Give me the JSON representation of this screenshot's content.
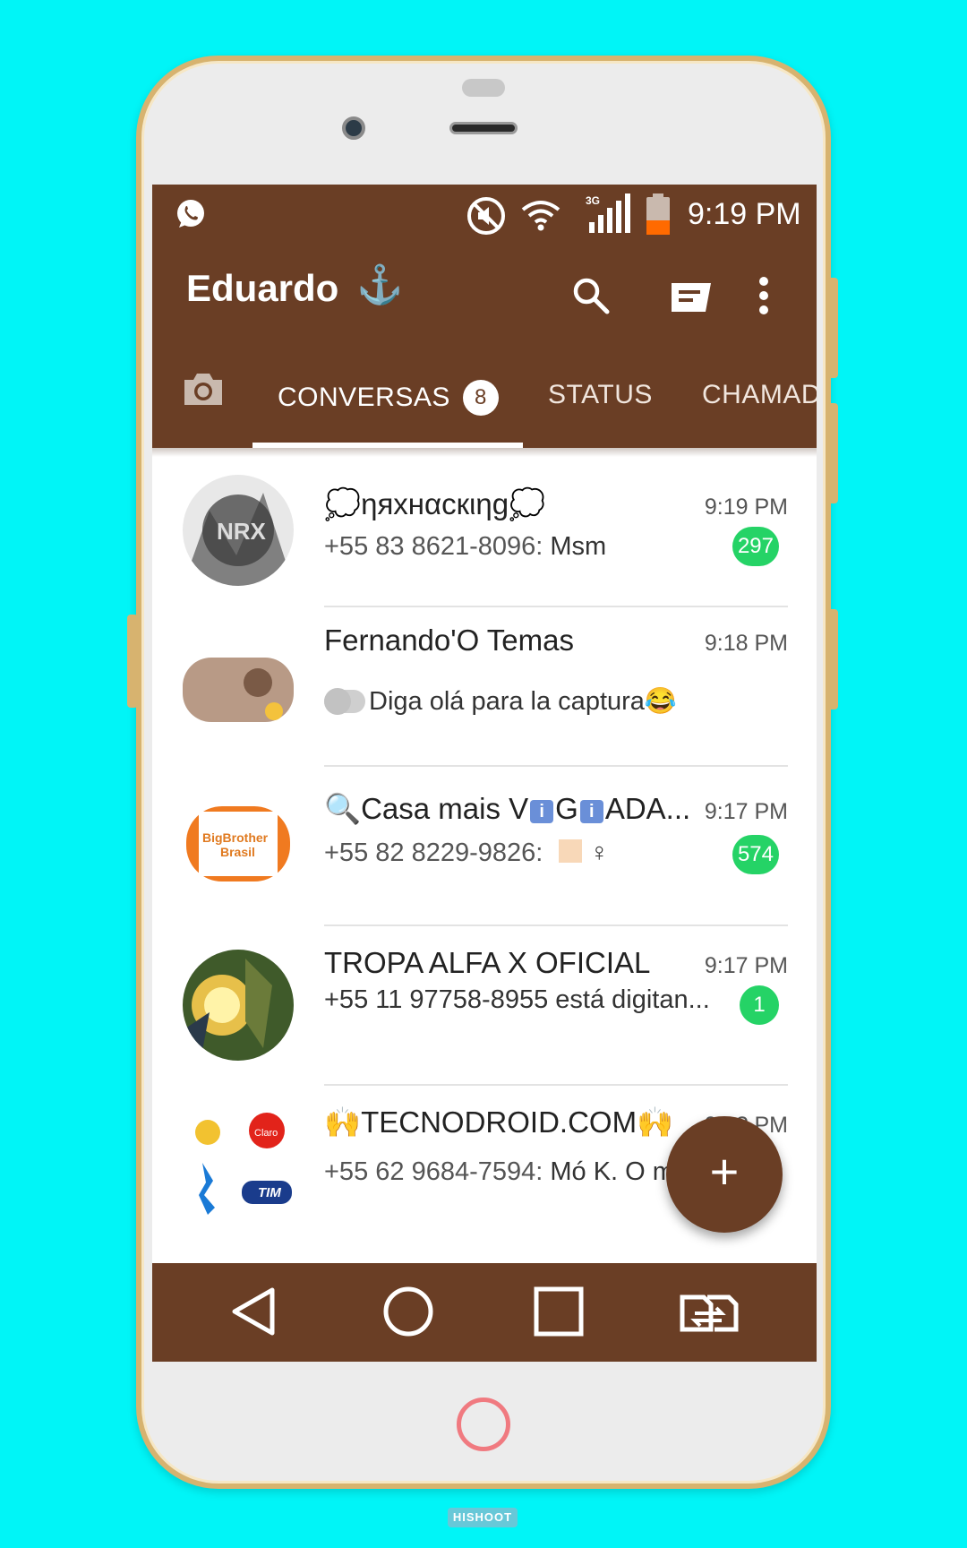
{
  "status_bar": {
    "time": "9:19 PM",
    "network": "3G"
  },
  "app_bar": {
    "title": "Eduardo",
    "title_emoji": "⚓"
  },
  "tabs": [
    {
      "label": "CONVERSAS",
      "badge": "8"
    },
    {
      "label": "STATUS"
    },
    {
      "label": "CHAMADAS"
    }
  ],
  "chats": [
    {
      "name": "💭ηяxнαcкιηg💭",
      "time": "9:19 PM",
      "sender": "+55 83 8621-8096:",
      "message": "Msm",
      "unread": "297"
    },
    {
      "name": "Fernando'O Temas",
      "time": "9:18 PM",
      "sender": "",
      "message": "Diga olá para la captura😂",
      "unread": ""
    },
    {
      "name_prefix": "🔍Casa mais V",
      "name_mid": "G",
      "name_suffix": "ADA...",
      "name_info": "i",
      "time": "9:17 PM",
      "sender": "+55 82 8229-9826:",
      "message": "♀",
      "unread": "574"
    },
    {
      "name": "TROPA ALFA X OFICIAL",
      "time": "9:17 PM",
      "sender": "",
      "message": "+55 11 97758-8955 está digitan...",
      "unread": "1"
    },
    {
      "name": "🙌TECNODROID.COM🙌",
      "time": "9:1? PM",
      "sender": "+55 62 9684-7594:",
      "message": "Mó K. O m",
      "unread": ""
    }
  ],
  "fab": {
    "label": "+"
  },
  "watermark": "HISHOOT",
  "colors": {
    "primary": "#6a3e25",
    "unread": "#25d366",
    "background": "#00f5f7",
    "frame_gold": "#d7b36f"
  }
}
